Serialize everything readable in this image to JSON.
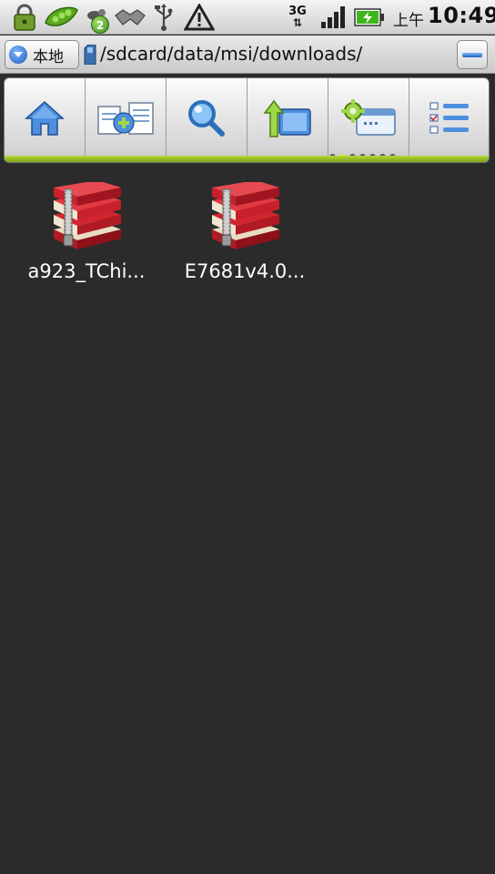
{
  "status_bar": {
    "icons": [
      "lock-icon",
      "peas-icon",
      "notification-icon",
      "handshake-icon",
      "usb-icon",
      "warning-icon",
      "network-3g-icon",
      "signal-icon",
      "battery-icon"
    ],
    "notification_count": "2",
    "network_type": "3G",
    "clock_ampm": "上午",
    "clock_time": "10:49",
    "colors": {
      "battery": "#3fb51c",
      "badge": "#4a9c25"
    }
  },
  "path_bar": {
    "location_label": "本地",
    "path": "/sdcard/data/msi/downloads/"
  },
  "toolbar": {
    "buttons": [
      "home-icon",
      "multi-select-icon",
      "search-icon",
      "up-folder-icon",
      "settings-window-icon",
      "list-view-icon"
    ],
    "page_indicator": {
      "total": 7,
      "active": 2
    },
    "accent": "#9cc624"
  },
  "files": [
    {
      "name": "a923_TChi...",
      "icon": "winrar-archive-icon"
    },
    {
      "name": "E7681v4.0...",
      "icon": "winrar-archive-icon"
    }
  ],
  "colors": {
    "background": "#2b2b2b",
    "archive_red": "#c8202c"
  }
}
